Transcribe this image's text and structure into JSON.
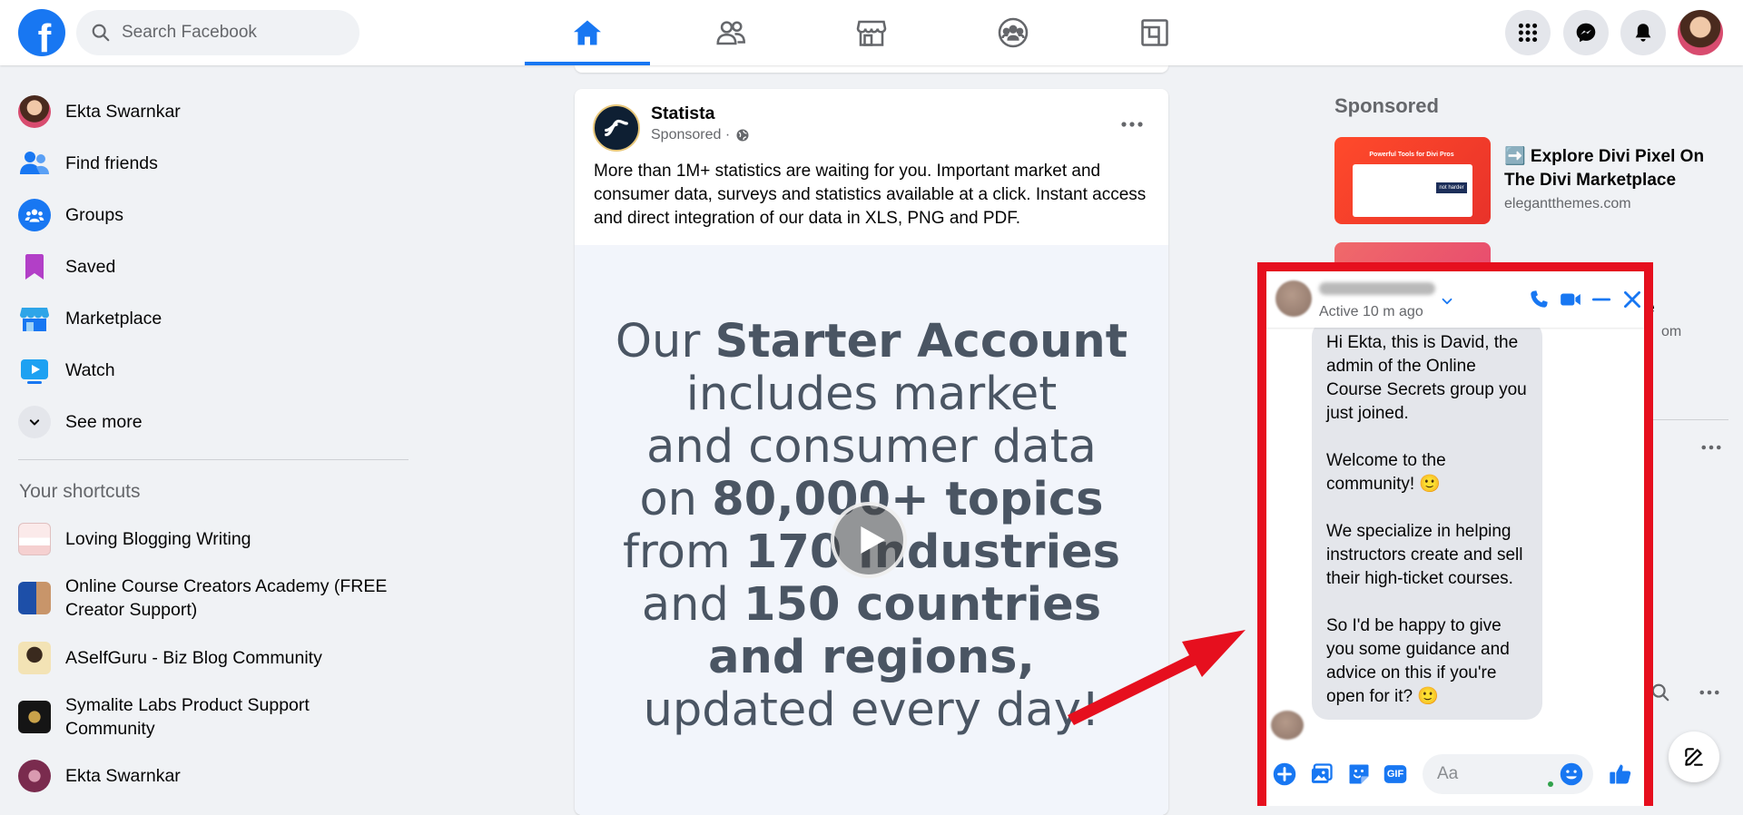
{
  "colors": {
    "brand": "#1877f2",
    "annotation": "#e60f1e",
    "background": "#f0f2f5"
  },
  "topbar": {
    "logo_letter": "f",
    "search_placeholder": "Search Facebook",
    "nav_tabs": [
      {
        "name": "home",
        "icon": "home-icon",
        "active": true
      },
      {
        "name": "friends",
        "icon": "friends-icon",
        "active": false
      },
      {
        "name": "marketplace",
        "icon": "marketplace-icon",
        "active": false
      },
      {
        "name": "groups",
        "icon": "groups-icon",
        "active": false
      },
      {
        "name": "gaming",
        "icon": "gaming-icon",
        "active": false
      }
    ],
    "right_icons": [
      "menu-grid-icon",
      "messenger-icon",
      "notifications-icon",
      "profile-avatar"
    ]
  },
  "sidebar": {
    "items": [
      {
        "label": "Ekta Swarnkar",
        "icon": "profile-avatar"
      },
      {
        "label": "Find friends",
        "icon": "friends-icon"
      },
      {
        "label": "Groups",
        "icon": "groups-icon"
      },
      {
        "label": "Saved",
        "icon": "bookmark-icon"
      },
      {
        "label": "Marketplace",
        "icon": "marketplace-icon"
      },
      {
        "label": "Watch",
        "icon": "watch-icon"
      },
      {
        "label": "See more",
        "icon": "chevron-down-icon"
      }
    ],
    "shortcuts_title": "Your shortcuts",
    "shortcuts": [
      {
        "label": "Loving Blogging Writing"
      },
      {
        "label": "Online Course Creators Academy (FREE Creator Support)"
      },
      {
        "label": "ASelfGuru - Biz Blog Community"
      },
      {
        "label": "Symalite Labs Product Support Community"
      },
      {
        "label": "Ekta Swarnkar"
      }
    ]
  },
  "post": {
    "page_name": "Statista",
    "meta": "Sponsored ·",
    "text": "More than 1M+ statistics are waiting for you. Important market and consumer data, surveys and statistics available at a click. Instant access and direct integration of our data in XLS, PNG and PDF.",
    "image_lines": [
      {
        "parts": [
          {
            "t": "Our ",
            "b": false
          },
          {
            "t": "Starter Account",
            "b": true
          }
        ]
      },
      {
        "parts": [
          {
            "t": "includes market",
            "b": false
          }
        ]
      },
      {
        "parts": [
          {
            "t": "and consumer data",
            "b": false
          }
        ]
      },
      {
        "parts": [
          {
            "t": "on ",
            "b": false
          },
          {
            "t": "80,000+ topics",
            "b": true
          }
        ]
      },
      {
        "parts": [
          {
            "t": "from ",
            "b": false
          },
          {
            "t": "170 industries",
            "b": true
          }
        ]
      },
      {
        "parts": [
          {
            "t": "and ",
            "b": false
          },
          {
            "t": "150 countries",
            "b": true
          }
        ]
      },
      {
        "parts": [
          {
            "t": "and regions,",
            "b": true
          }
        ]
      },
      {
        "parts": [
          {
            "t": "updated every day!",
            "b": false
          }
        ]
      }
    ]
  },
  "right_column": {
    "sponsored_title": "Sponsored",
    "ad1": {
      "title": "➡️ Explore Divi Pixel On The Divi Marketplace",
      "domain": "elegantthemes.com",
      "image_caption": "Powerful Tools for Divi Pros",
      "image_button": "not harder"
    },
    "ad2": {
      "title_tail": "nce",
      "domain_tail": "om"
    }
  },
  "chat": {
    "status": "Active 10 m ago",
    "message_paragraphs": [
      "Hi Ekta, this is David, the admin of the Online Course Secrets group you just joined.",
      "Welcome to the community! 🙂",
      "We specialize in helping instructors create and sell their high-ticket courses.",
      "So I'd be happy to give you some guidance and advice on this if you're open for it? 🙂"
    ],
    "input_placeholder": "Aa",
    "gif_label": "GIF"
  }
}
